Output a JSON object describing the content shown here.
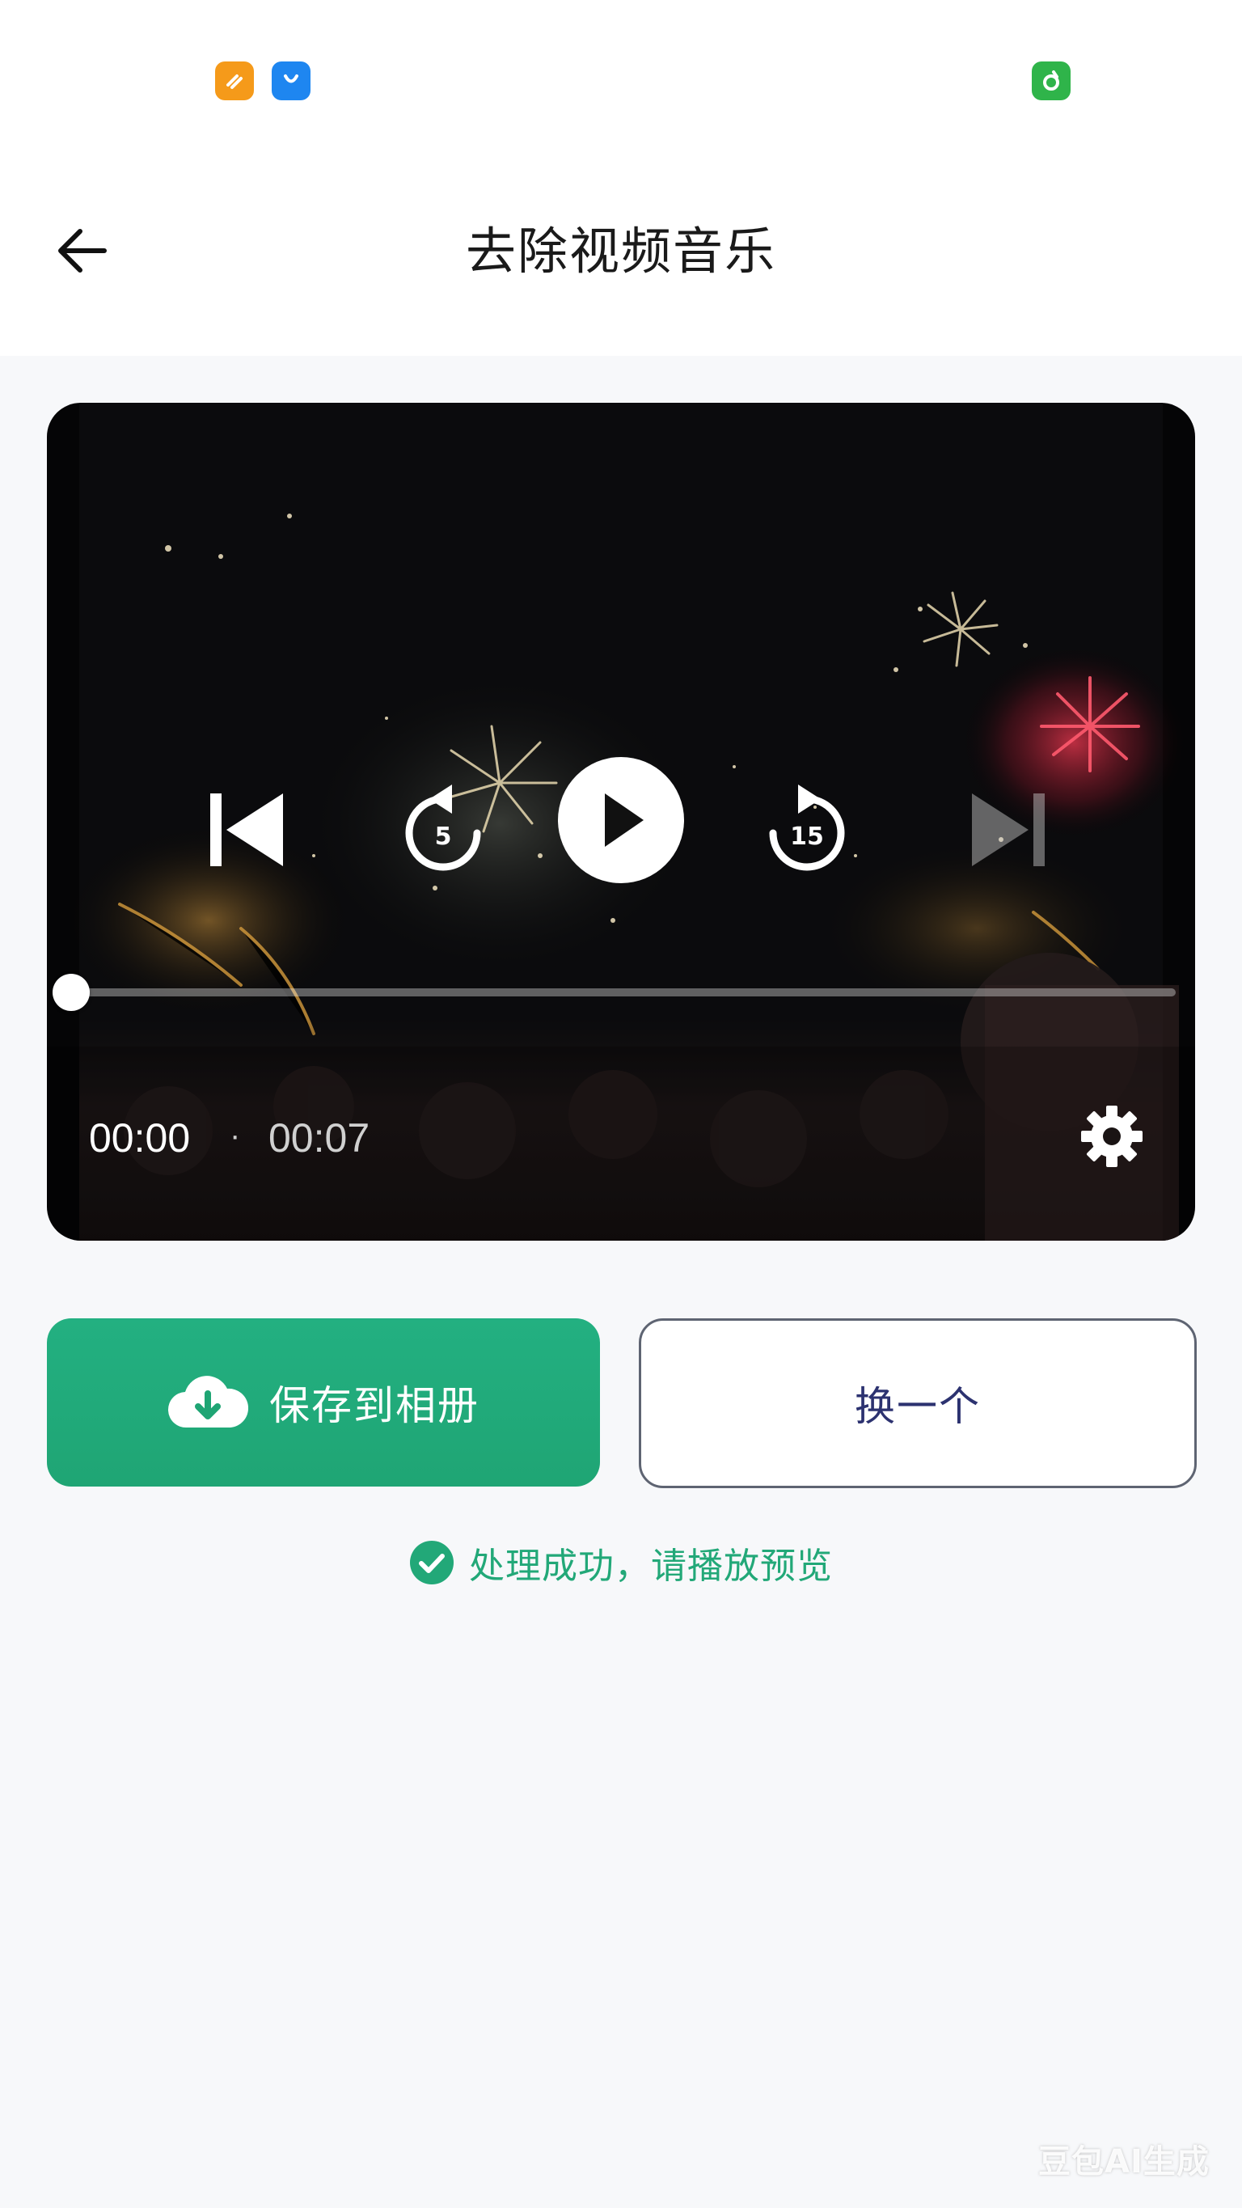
{
  "status_bar": {
    "icons": [
      "orange-app-icon",
      "shopping-bag-icon",
      "green-app-icon"
    ]
  },
  "header": {
    "title": "去除视频音乐",
    "back_icon": "arrow-left-icon"
  },
  "player": {
    "controls": [
      "skip-previous-icon",
      "rewind-5-icon",
      "play-icon",
      "forward-15-icon",
      "skip-next-icon"
    ],
    "rewind_label": "5",
    "forward_label": "15",
    "current_time": "00:00",
    "separator": "·",
    "total_time": "00:07",
    "progress": 0,
    "settings_icon": "gear-icon"
  },
  "actions": {
    "save_label": "保存到相册",
    "save_icon": "cloud-download-icon",
    "swap_label": "换一个"
  },
  "status": {
    "message": "处理成功，请播放预览",
    "icon": "check-circle-icon"
  },
  "watermark": "豆包AI生成",
  "colors": {
    "accent_green": "#1fa574",
    "status_green": "#22a878",
    "swap_text": "#2c3270"
  }
}
